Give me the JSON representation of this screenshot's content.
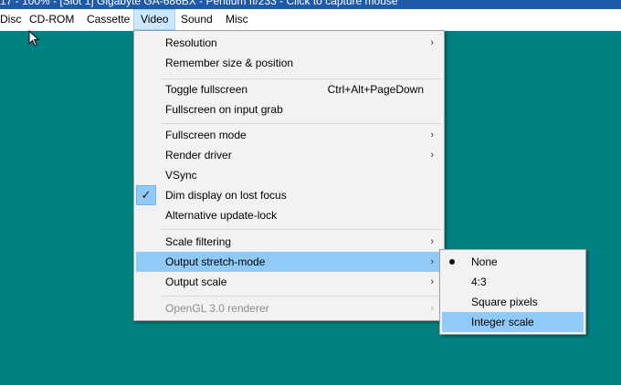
{
  "window": {
    "title": "17 - 100% - [Slot 1] Gigabyte GA-686BX - Pentium II/233 - Click to capture mouse"
  },
  "menubar": {
    "items": [
      {
        "label": "Disc"
      },
      {
        "label": "CD-ROM"
      },
      {
        "label": "Cassette"
      },
      {
        "label": "Video"
      },
      {
        "label": "Sound"
      },
      {
        "label": "Misc"
      }
    ]
  },
  "video_menu": {
    "items": [
      {
        "label": "Resolution",
        "submenu": true
      },
      {
        "label": "Remember size & position"
      },
      {
        "label": "Toggle fullscreen",
        "shortcut": "Ctrl+Alt+PageDown"
      },
      {
        "label": "Fullscreen on input grab"
      },
      {
        "label": "Fullscreen mode",
        "submenu": true
      },
      {
        "label": "Render driver",
        "submenu": true
      },
      {
        "label": "VSync"
      },
      {
        "label": "Dim display on lost focus",
        "checked": true
      },
      {
        "label": "Alternative update-lock"
      },
      {
        "label": "Scale filtering",
        "submenu": true
      },
      {
        "label": "Output stretch-mode",
        "submenu": true,
        "highlighted": true
      },
      {
        "label": "Output scale",
        "submenu": true
      },
      {
        "label": "OpenGL 3.0 renderer",
        "submenu": true,
        "disabled": true
      }
    ],
    "check_glyph": "✓",
    "arrow_glyph": "›"
  },
  "stretch_submenu": {
    "items": [
      {
        "label": "None",
        "selected": true
      },
      {
        "label": "4:3"
      },
      {
        "label": "Square pixels"
      },
      {
        "label": "Integer scale",
        "highlighted": true
      }
    ]
  },
  "colors": {
    "desktop": "#008080",
    "menu_bg": "#f2f2f2",
    "highlight": "#91c9f7",
    "menubar_active": "#cce8ff"
  },
  "icons": {
    "cursor": "mouse-pointer-icon",
    "check": "check-icon",
    "submenu_arrow": "chevron-right-icon",
    "radio": "radio-bullet-icon"
  }
}
